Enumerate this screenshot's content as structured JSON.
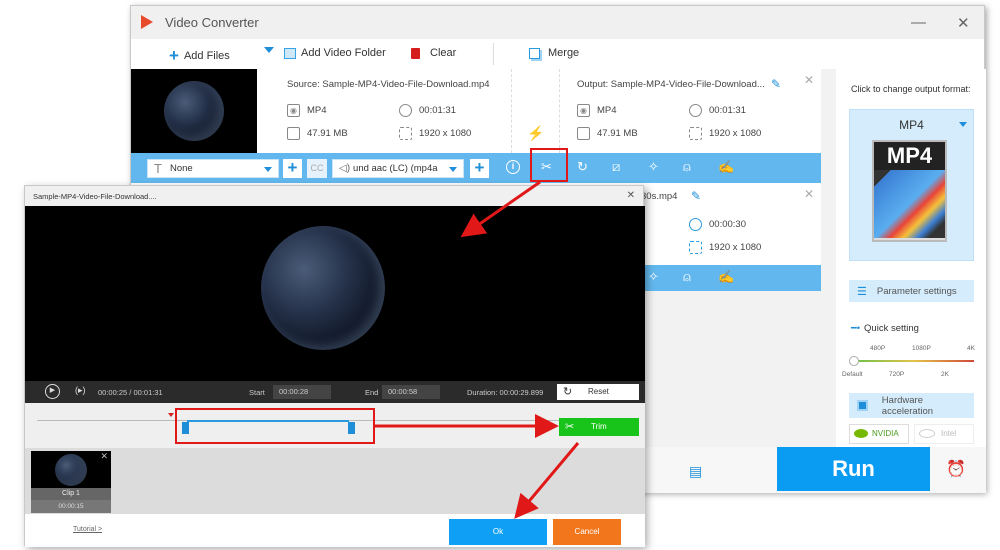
{
  "app": {
    "title": "Video Converter",
    "minimize": "—",
    "close": "✕"
  },
  "toolbar": {
    "add_files": "Add Files",
    "add_folder": "Add Video Folder",
    "clear": "Clear",
    "merge": "Merge"
  },
  "file1": {
    "source": "Source: Sample-MP4-Video-File-Download.mp4",
    "src_format": "MP4",
    "src_duration": "00:01:31",
    "src_size": "47.91 MB",
    "src_resolution": "1920 x 1080",
    "output": "Output: Sample-MP4-Video-File-Download...",
    "out_format": "MP4",
    "out_duration": "00:01:31",
    "out_size": "47.91 MB",
    "out_resolution": "1920 x 1080",
    "subtitle_select": "None",
    "audio_select": "und aac (LC) (mp4a"
  },
  "file2": {
    "output_suffix": "30s.mp4",
    "out_duration": "00:00:30",
    "out_resolution": "1920 x 1080"
  },
  "right_panel": {
    "format_hint": "Click to change output format:",
    "format": "MP4",
    "format_image_label": "MP4",
    "parameter_settings": "Parameter settings",
    "quick_setting": "Quick setting",
    "quality_top": [
      "480P",
      "1080P",
      "4K"
    ],
    "quality_bottom": [
      "Default",
      "720P",
      "2K"
    ],
    "hardware_accel": "Hardware acceleration",
    "nvidia": "NVIDIA",
    "intel": "Intel"
  },
  "run": "Run",
  "trim": {
    "title": "Sample-MP4-Video-File-Download....",
    "close": "✕",
    "current_time": "00:00:25",
    "total_time": "00:01:31",
    "time_sep": "/",
    "start_label": "Start",
    "start_value": "00:00:28",
    "end_label": "End",
    "end_value": "00:00:58",
    "duration_label": "Duration:",
    "duration_value": "00:00:29.899",
    "reset": "Reset",
    "trim_button": "Trim",
    "clip_name": "Clip 1",
    "clip_duration": "00:00:15",
    "tutorial": "Tutorial >",
    "ok": "Ok",
    "cancel": "Cancel"
  },
  "colors": {
    "accent_blue": "#0a9cf3",
    "option_bar": "#62b8ee",
    "trim_green": "#19c41a",
    "cancel_orange": "#f2761c",
    "highlight_red": "#e01818"
  }
}
